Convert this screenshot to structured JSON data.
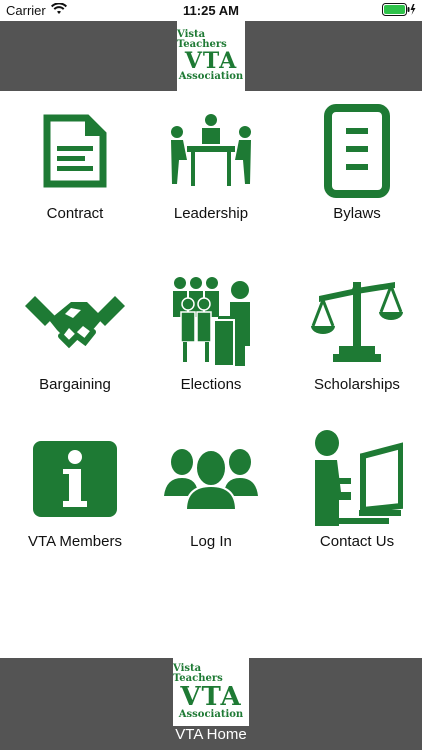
{
  "status_bar": {
    "carrier": "Carrier",
    "time": "11:25 AM"
  },
  "logo": {
    "line1": "Vista Teachers",
    "line2": "VTA",
    "line3": "Association"
  },
  "tiles": [
    {
      "label": "Contract",
      "icon": "document-icon"
    },
    {
      "label": "Leadership",
      "icon": "meeting-icon"
    },
    {
      "label": "Bylaws",
      "icon": "list-icon"
    },
    {
      "label": "Bargaining",
      "icon": "handshake-icon"
    },
    {
      "label": "Elections",
      "icon": "ballot-box-icon"
    },
    {
      "label": "Scholarships",
      "icon": "scales-icon"
    },
    {
      "label": "VTA Members",
      "icon": "info-icon"
    },
    {
      "label": "Log In",
      "icon": "people-icon"
    },
    {
      "label": "Contact Us",
      "icon": "computer-user-icon"
    }
  ],
  "footer": {
    "home_label": "VTA Home"
  },
  "colors": {
    "brand_green": "#1e7a34",
    "bar_gray": "#545454"
  }
}
